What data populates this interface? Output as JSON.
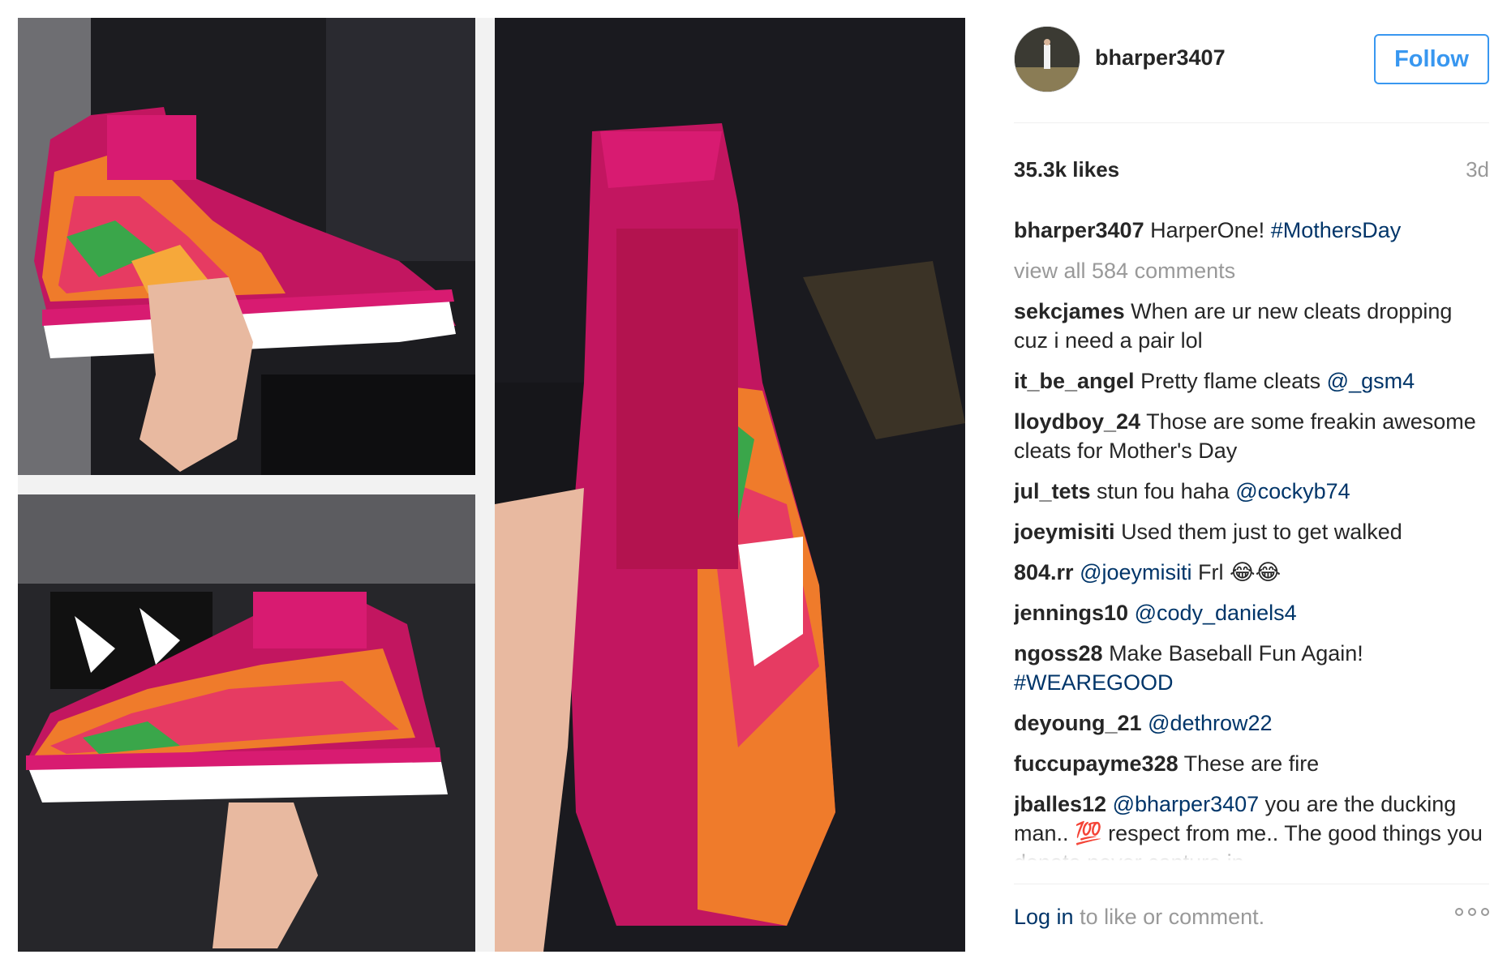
{
  "post": {
    "username": "bharper3407",
    "follow_label": "Follow",
    "likes": "35.3k likes",
    "time": "3d"
  },
  "caption": {
    "user": "bharper3407",
    "text": "HarperOne!",
    "hashtag": "#MothersDay"
  },
  "view_all": "view all 584 comments",
  "comments": [
    {
      "user": "sekcjames",
      "text": "When are ur new cleats dropping cuz i need a pair lol",
      "mention": ""
    },
    {
      "user": "it_be_angel",
      "text": "Pretty flame cleats",
      "mention": "@_gsm4"
    },
    {
      "user": "lloydboy_24",
      "text": "Those are some freakin awesome cleats for Mother's Day",
      "mention": ""
    },
    {
      "user": "jul_tets",
      "text": "stun fou haha",
      "mention": "@cockyb74"
    },
    {
      "user": "joeymisiti",
      "text": "Used them just to get walked",
      "mention": ""
    },
    {
      "user": "804.rr",
      "text": "",
      "mention": "@joeymisiti",
      "after": "Frl 😂😂"
    },
    {
      "user": "jennings10",
      "text": "",
      "mention": "@cody_daniels4"
    },
    {
      "user": "ngoss28",
      "text": "Make Baseball Fun Again!",
      "mention": "#WEAREGOOD"
    },
    {
      "user": "deyoung_21",
      "text": "",
      "mention": "@dethrow22"
    },
    {
      "user": "fuccupayme328",
      "text": "These are fire",
      "mention": ""
    },
    {
      "user": "jballes12",
      "text": "",
      "mention": "@bharper3407",
      "after": "you are the ducking man.. 💯 respect from me.. The good things you donate never capture in"
    }
  ],
  "footer": {
    "login_link": "Log in",
    "login_rest": " to like or comment."
  },
  "colors": {
    "accent": "#3897f0",
    "link": "#003569",
    "muted": "#999999",
    "cleat_pink": "#c2185b"
  }
}
